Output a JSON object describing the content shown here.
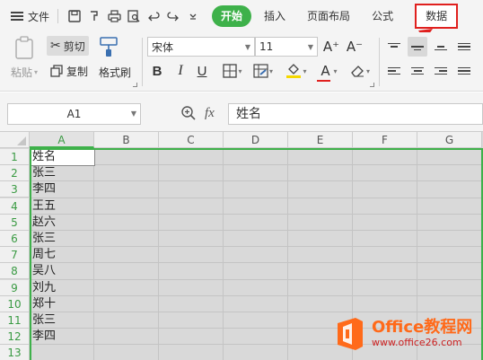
{
  "menubar": {
    "file_label": "文件",
    "quick_access_icons": [
      "save-icon",
      "format-painter-icon",
      "print-icon",
      "print-preview-icon",
      "undo-icon",
      "redo-icon",
      "more-dropdown-icon"
    ],
    "tabs": [
      {
        "label": "开始",
        "active": true
      },
      {
        "label": "插入",
        "active": false
      },
      {
        "label": "页面布局",
        "active": false
      },
      {
        "label": "公式",
        "active": false
      },
      {
        "label": "数据",
        "active": false,
        "highlighted": true
      }
    ]
  },
  "ribbon": {
    "paste_label": "粘贴",
    "cut_label": "剪切",
    "copy_label": "复制",
    "format_painter_label": "格式刷",
    "font_name": "宋体",
    "font_size": "11",
    "grow_font_glyph": "A⁺",
    "shrink_font_glyph": "A⁻",
    "bold_glyph": "B",
    "italic_glyph": "I",
    "underline_glyph": "U",
    "font_color_glyph": "A",
    "font_color": "#e0201e",
    "fill_color": "#f5d800"
  },
  "formula_bar": {
    "name_box": "A1",
    "zoom_glyph": "⊕",
    "fx_label": "fx",
    "content": "姓名"
  },
  "sheet": {
    "columns": [
      "A",
      "B",
      "C",
      "D",
      "E",
      "F",
      "G"
    ],
    "rows": [
      "1",
      "2",
      "3",
      "4",
      "5",
      "6",
      "7",
      "8",
      "9",
      "10",
      "11",
      "12",
      "13"
    ],
    "column_a": [
      "姓名",
      "张三",
      "李四",
      "王五",
      "赵六",
      "张三",
      "周七",
      "吴八",
      "刘九",
      "郑十",
      "张三",
      "李四",
      ""
    ]
  },
  "watermark": {
    "title": "Office教程网",
    "url": "www.office26.com"
  },
  "colors": {
    "accent_green": "#3eb14a",
    "highlight_red": "#e0201e",
    "watermark_orange": "#ff6a1a"
  }
}
